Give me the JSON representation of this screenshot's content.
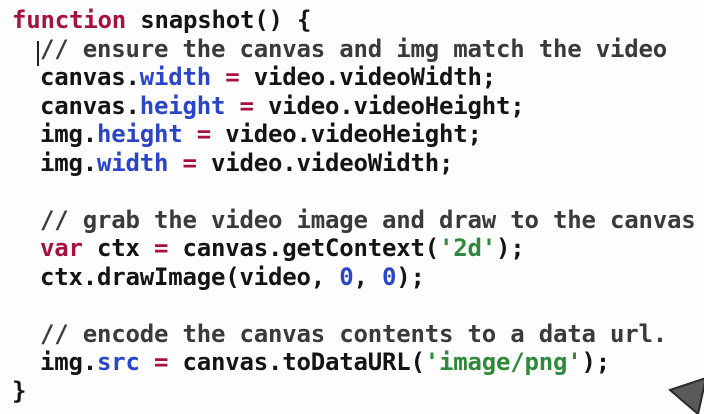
{
  "lines": [
    {
      "indent": 0,
      "tokens": [
        {
          "t": "function",
          "c": "kw"
        },
        {
          "t": " ",
          "c": "plain"
        },
        {
          "t": "snapshot",
          "c": "plain"
        },
        {
          "t": "() {",
          "c": "plain"
        }
      ]
    },
    {
      "indent": 1,
      "tokens": [
        {
          "t": "// ensure the canvas and img match the video",
          "c": "cm"
        }
      ]
    },
    {
      "indent": 1,
      "tokens": [
        {
          "t": "canvas",
          "c": "plain"
        },
        {
          "t": ".",
          "c": "plain"
        },
        {
          "t": "width",
          "c": "prop"
        },
        {
          "t": " ",
          "c": "plain"
        },
        {
          "t": "=",
          "c": "op"
        },
        {
          "t": " video.videoWidth;",
          "c": "plain"
        }
      ]
    },
    {
      "indent": 1,
      "tokens": [
        {
          "t": "canvas",
          "c": "plain"
        },
        {
          "t": ".",
          "c": "plain"
        },
        {
          "t": "height",
          "c": "prop"
        },
        {
          "t": " ",
          "c": "plain"
        },
        {
          "t": "=",
          "c": "op"
        },
        {
          "t": " video.videoHeight;",
          "c": "plain"
        }
      ]
    },
    {
      "indent": 1,
      "tokens": [
        {
          "t": "img",
          "c": "plain"
        },
        {
          "t": ".",
          "c": "plain"
        },
        {
          "t": "height",
          "c": "prop"
        },
        {
          "t": " ",
          "c": "plain"
        },
        {
          "t": "=",
          "c": "op"
        },
        {
          "t": " video.videoHeight;",
          "c": "plain"
        }
      ]
    },
    {
      "indent": 1,
      "tokens": [
        {
          "t": "img",
          "c": "plain"
        },
        {
          "t": ".",
          "c": "plain"
        },
        {
          "t": "width",
          "c": "prop"
        },
        {
          "t": " ",
          "c": "plain"
        },
        {
          "t": "=",
          "c": "op"
        },
        {
          "t": " video.videoWidth;",
          "c": "plain"
        }
      ]
    },
    {
      "indent": 0,
      "tokens": []
    },
    {
      "indent": 1,
      "tokens": [
        {
          "t": "// grab the video image and draw to the canvas",
          "c": "cm"
        }
      ]
    },
    {
      "indent": 1,
      "tokens": [
        {
          "t": "var",
          "c": "kw"
        },
        {
          "t": " ctx ",
          "c": "plain"
        },
        {
          "t": "=",
          "c": "op"
        },
        {
          "t": " canvas.getContext(",
          "c": "plain"
        },
        {
          "t": "'2d'",
          "c": "str"
        },
        {
          "t": ");",
          "c": "plain"
        }
      ]
    },
    {
      "indent": 1,
      "tokens": [
        {
          "t": "ctx.drawImage(video, ",
          "c": "plain"
        },
        {
          "t": "0",
          "c": "num"
        },
        {
          "t": ", ",
          "c": "plain"
        },
        {
          "t": "0",
          "c": "num"
        },
        {
          "t": ");",
          "c": "plain"
        }
      ]
    },
    {
      "indent": 0,
      "tokens": []
    },
    {
      "indent": 1,
      "tokens": [
        {
          "t": "// encode the canvas contents to a data url.",
          "c": "cm"
        }
      ]
    },
    {
      "indent": 1,
      "tokens": [
        {
          "t": "img",
          "c": "plain"
        },
        {
          "t": ".",
          "c": "plain"
        },
        {
          "t": "src",
          "c": "prop"
        },
        {
          "t": " ",
          "c": "plain"
        },
        {
          "t": "=",
          "c": "op"
        },
        {
          "t": " canvas.toDataURL(",
          "c": "plain"
        },
        {
          "t": "'image/png'",
          "c": "str"
        },
        {
          "t": ");",
          "c": "plain"
        }
      ]
    },
    {
      "indent": 0,
      "tokens": [
        {
          "t": "}",
          "c": "plain"
        }
      ]
    }
  ],
  "colors": {
    "keyword": "#a6113f",
    "property": "#2a45c8",
    "string": "#2e8a3a",
    "number": "#2a45c8",
    "comment": "#3a3a3a",
    "text": "#141414",
    "background": "#fdfdfd"
  },
  "icons": {
    "pointer": "mouse-pointer-icon"
  }
}
